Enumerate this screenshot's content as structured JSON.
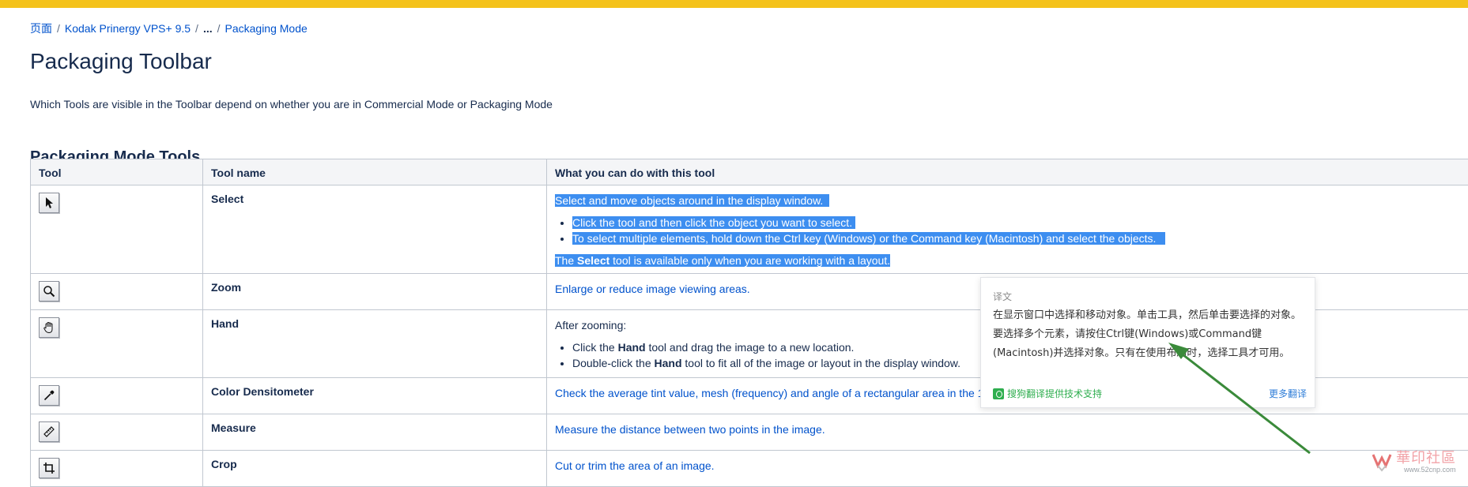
{
  "accent_bar_color": "#f4c21b",
  "breadcrumb": {
    "items": [
      "页面",
      "Kodak Prinergy VPS+ 9.5",
      "...",
      "Packaging Mode"
    ],
    "separator": "/"
  },
  "page_title": "Packaging Toolbar",
  "intro": "Which Tools are visible in the Toolbar depend on whether you are in Commercial Mode or Packaging Mode",
  "section_title": "Packaging Mode Tools",
  "table": {
    "headers": [
      "Tool",
      "Tool name",
      "What you can do with this tool"
    ],
    "rows": [
      {
        "icon": "arrow-pointer-icon",
        "name": "Select",
        "desc_intro": "Select and move objects around in the display window.",
        "bullets": [
          "Click the tool and then click the object you want to select.",
          "To select multiple elements, hold down the Ctrl key (Windows) or the Command key (Macintosh) and select the objects."
        ],
        "note_pre": "The ",
        "note_bold": "Select",
        "note_post": " tool is available only when you are working with a layout."
      },
      {
        "icon": "magnifier-icon",
        "name": "Zoom",
        "desc": "Enlarge or reduce image viewing areas."
      },
      {
        "icon": "hand-icon",
        "name": "Hand",
        "desc_intro": "After zooming:",
        "bullets": [
          {
            "pre": "Click the ",
            "bold": "Hand",
            "post": " tool and drag the image to a new location."
          },
          {
            "pre": "Double-click the ",
            "bold": "Hand",
            "post": " tool to fit all of the image or layout in the display window."
          }
        ]
      },
      {
        "icon": "eyedropper-icon",
        "name": "Color Densitometer",
        "desc": "Check the average tint value, mesh (frequency) and angle of a rectangular area in the 1-"
      },
      {
        "icon": "ruler-icon",
        "name": "Measure",
        "desc": "Measure the distance between two points in the image."
      },
      {
        "icon": "crop-icon",
        "name": "Crop",
        "desc": "Cut or trim the area of an image."
      }
    ]
  },
  "translation_popup": {
    "label": "译文",
    "text": "在显示窗口中选择和移动对象。单击工具，然后单击要选择的对象。要选择多个元素，请按住Ctrl键(Windows)或Command键(Macintosh)并选择对象。只有在使用布局时，选择工具才可用。",
    "provider": "搜狗翻译提供技术支持",
    "more": "更多翻译"
  },
  "arrow_color": "#3a8a3a",
  "watermark": {
    "text": "華印社區",
    "url": "www.52cnp.com"
  }
}
